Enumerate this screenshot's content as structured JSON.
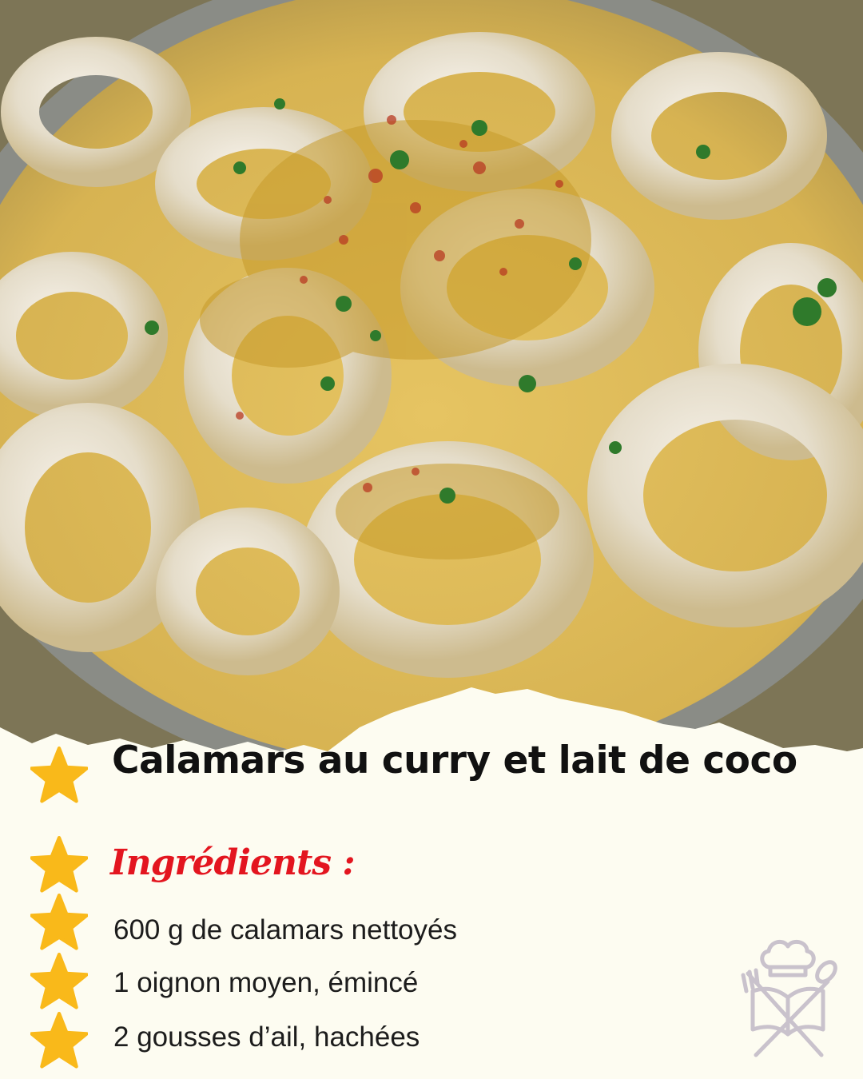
{
  "recipe": {
    "title": "Calamars au curry et lait de coco",
    "ingredients_heading": "Ingrédients :",
    "ingredients": [
      "600 g de calamars nettoyés",
      "1 oignon moyen, émincé",
      "2 gousses d’ail, hachées"
    ]
  },
  "icons": {
    "bullet": "star-icon",
    "logo": "chef-hat-book-cutlery-icon"
  },
  "colors": {
    "background": "#fdfcf1",
    "title": "#111111",
    "heading": "#e3151f",
    "star": "#f9b91a",
    "logo": "#c9c2cc"
  }
}
